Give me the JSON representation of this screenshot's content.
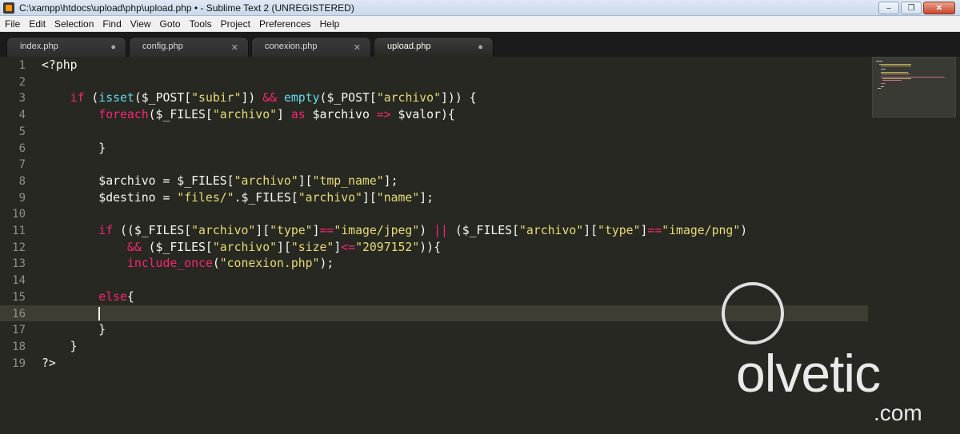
{
  "window": {
    "title": "C:\\xampp\\htdocs\\upload\\php\\upload.php • - Sublime Text 2 (UNREGISTERED)",
    "app_icon": "sublime-text-icon",
    "minimize": "–",
    "maximize": "❐",
    "close": "✕"
  },
  "menu": [
    "File",
    "Edit",
    "Selection",
    "Find",
    "View",
    "Goto",
    "Tools",
    "Project",
    "Preferences",
    "Help"
  ],
  "tabs": [
    {
      "label": "index.php",
      "indicator": "●",
      "active": false
    },
    {
      "label": "config.php",
      "indicator": "✕",
      "active": false
    },
    {
      "label": "conexion.php",
      "indicator": "✕",
      "active": false
    },
    {
      "label": "upload.php",
      "indicator": "●",
      "active": true
    }
  ],
  "editor": {
    "current_line": 16,
    "lines": [
      {
        "n": "1",
        "text": "<?php"
      },
      {
        "n": "2",
        "text": ""
      },
      {
        "n": "3",
        "text": "    if (isset($_POST[\"subir\"]) && empty($_POST[\"archivo\"])) {"
      },
      {
        "n": "4",
        "text": "        foreach($_FILES[\"archivo\"] as $archivo => $valor){"
      },
      {
        "n": "5",
        "text": ""
      },
      {
        "n": "6",
        "text": "        }"
      },
      {
        "n": "7",
        "text": ""
      },
      {
        "n": "8",
        "text": "        $archivo = $_FILES[\"archivo\"][\"tmp_name\"];"
      },
      {
        "n": "9",
        "text": "        $destino = \"files/\".$_FILES[\"archivo\"][\"name\"];"
      },
      {
        "n": "10",
        "text": ""
      },
      {
        "n": "11",
        "text": "        if (($_FILES[\"archivo\"][\"type\"]==\"image/jpeg\") || ($_FILES[\"archivo\"][\"type\"]==\"image/png\")"
      },
      {
        "n": "12",
        "text": "            && ($_FILES[\"archivo\"][\"size\"]<=\"2097152\")){"
      },
      {
        "n": "13",
        "text": "            include_once(\"conexion.php\");"
      },
      {
        "n": "14",
        "text": ""
      },
      {
        "n": "15",
        "text": "        else{"
      },
      {
        "n": "16",
        "text": "        "
      },
      {
        "n": "17",
        "text": "        }"
      },
      {
        "n": "18",
        "text": "    }"
      },
      {
        "n": "19",
        "text": "?>"
      }
    ]
  },
  "watermark": {
    "brand": "olvetic",
    "suffix": ".com"
  },
  "colors": {
    "background": "#272822",
    "keyword": "#f92672",
    "function": "#66d9ef",
    "string": "#e6db74",
    "text": "#f8f8f2"
  }
}
